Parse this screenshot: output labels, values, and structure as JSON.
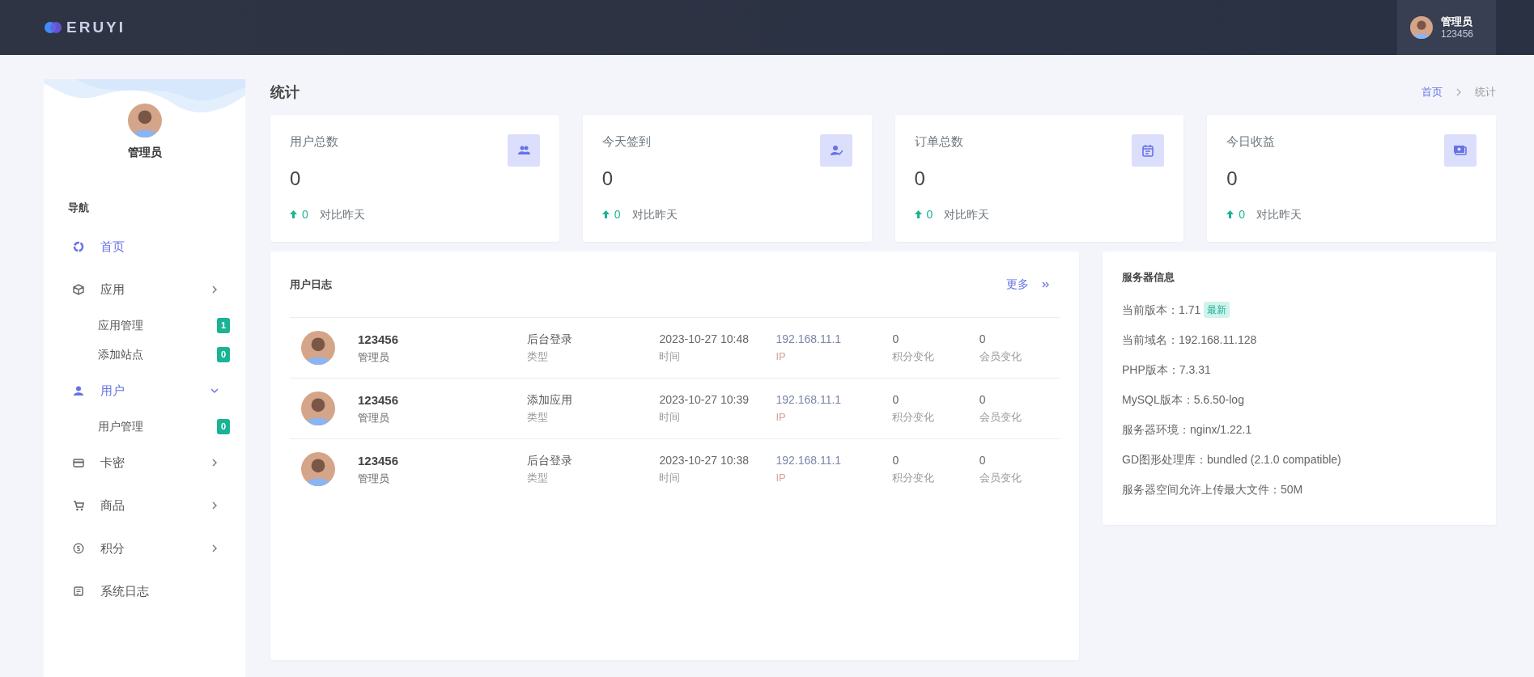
{
  "topbar": {
    "logo": "ERUYI",
    "user": {
      "name": "管理员",
      "account": "123456"
    }
  },
  "sidebar": {
    "profile_name": "管理员",
    "section_label": "导航",
    "items": [
      {
        "label": "首页",
        "selected": true
      },
      {
        "label": "应用",
        "selected": false,
        "expanded": false,
        "children": [
          {
            "label": "应用管理",
            "badge": "1"
          },
          {
            "label": "添加站点",
            "badge": "0"
          }
        ]
      },
      {
        "label": "用户",
        "selected": true,
        "expanded": true,
        "children": [
          {
            "label": "用户管理",
            "badge": "0"
          }
        ]
      },
      {
        "label": "卡密",
        "selected": false,
        "expanded": false
      },
      {
        "label": "商品",
        "selected": false,
        "expanded": false
      },
      {
        "label": "积分",
        "selected": false,
        "expanded": false
      },
      {
        "label": "系统日志",
        "selected": false
      }
    ]
  },
  "page_title": "统计",
  "breadcrumb": [
    {
      "label": "首页",
      "selected": false
    },
    {
      "label": "统计",
      "selected": true
    }
  ],
  "stats": [
    {
      "title": "用户总数",
      "value": "0",
      "delta": "0",
      "compare": "对比昨天"
    },
    {
      "title": "今天签到",
      "value": "0",
      "delta": "0",
      "compare": "对比昨天"
    },
    {
      "title": "订单总数",
      "value": "0",
      "delta": "0",
      "compare": "对比昨天"
    },
    {
      "title": "今日收益",
      "value": "0",
      "delta": "0",
      "compare": "对比昨天"
    }
  ],
  "user_log": {
    "title": "用户日志",
    "more": "更多",
    "rows": [
      {
        "user": "123456",
        "role": "管理员",
        "fields": [
          {
            "value": "后台登录",
            "label": "类型"
          },
          {
            "value": "2023-10-27 10:48",
            "label": "时间"
          },
          {
            "value": "192.168.11.1",
            "label": "IP"
          },
          {
            "value": "0",
            "label": "积分变化"
          },
          {
            "value": "0",
            "label": "会员变化"
          }
        ]
      },
      {
        "user": "123456",
        "role": "管理员",
        "fields": [
          {
            "value": "添加应用",
            "label": "类型"
          },
          {
            "value": "2023-10-27 10:39",
            "label": "时间"
          },
          {
            "value": "192.168.11.1",
            "label": "IP"
          },
          {
            "value": "0",
            "label": "积分变化"
          },
          {
            "value": "0",
            "label": "会员变化"
          }
        ]
      },
      {
        "user": "123456",
        "role": "管理员",
        "fields": [
          {
            "value": "后台登录",
            "label": "类型"
          },
          {
            "value": "2023-10-27 10:38",
            "label": "时间"
          },
          {
            "value": "192.168.11.1",
            "label": "IP"
          },
          {
            "value": "0",
            "label": "积分变化"
          },
          {
            "value": "0",
            "label": "会员变化"
          }
        ]
      }
    ]
  },
  "server_info": {
    "title": "服务器信息",
    "lines": [
      {
        "text": "当前版本：1.71",
        "badge": "最新"
      },
      {
        "text": "当前域名：192.168.11.128"
      },
      {
        "text": "PHP版本：7.3.31"
      },
      {
        "text": "MySQL版本：5.6.50-log"
      },
      {
        "text": "服务器环境：nginx/1.22.1"
      },
      {
        "text": "GD图形处理库：bundled (2.1.0 compatible)"
      },
      {
        "text": "服务器空间允许上传最大文件：50M"
      }
    ]
  }
}
